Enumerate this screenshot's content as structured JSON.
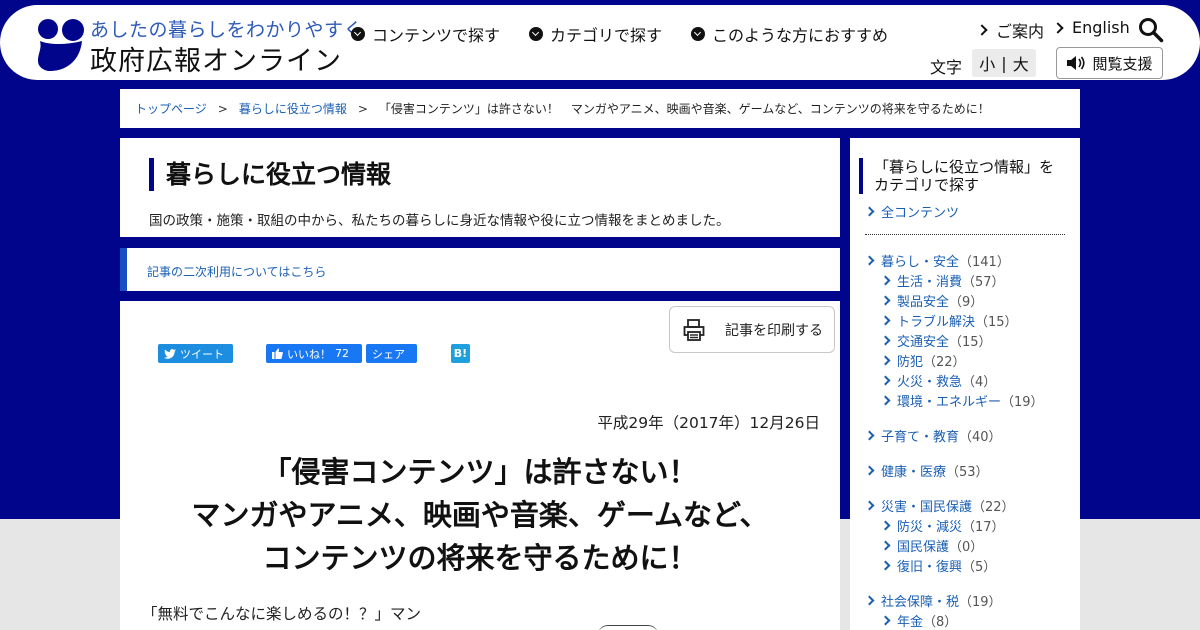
{
  "header": {
    "tagline": "あしたの暮らしをわかりやすく",
    "site_name": "政府広報オンライン",
    "nav": [
      "コンテンツで探す",
      "カテゴリで探す",
      "このような方におすすめ"
    ],
    "guide": "ご案内",
    "english": "English",
    "font_label": "文字",
    "font_small": "小",
    "font_sep": "|",
    "font_large": "大",
    "access_support": "閲覧支援"
  },
  "breadcrumb": {
    "top": "トップページ",
    "category": "暮らしに役立つ情報",
    "current": "「侵害コンテンツ」は許さない！　マンガやアニメ、映画や音楽、ゲームなど、コンテンツの将来を守るために！",
    "sep": ">"
  },
  "category_header": {
    "title": "暮らしに役立つ情報",
    "description": "国の政策・施策・取組の中から、私たちの暮らしに身近な情報や役に立つ情報をまとめました。"
  },
  "reuse_link": "記事の二次利用についてはこちら",
  "article": {
    "print_label": "記事を印刷する",
    "tweet": "ツイート",
    "like": "いいね！",
    "like_count": "72",
    "share": "シェア",
    "hatena": "B!",
    "date": "平成29年（2017年）12月26日",
    "headline_lines": [
      "「侵害コンテンツ」は許さない！",
      "マンガやアニメ、映画や音楽、ゲームなど、",
      "コンテンツの将来を守るために！"
    ],
    "lead": "「無料でこんなに楽しめるの！？」マン"
  },
  "sidebar": {
    "title_line1": "「暮らしに役立つ情報」を",
    "title_line2": "カテゴリで探す",
    "all": "全コンテンツ",
    "groups": [
      {
        "label": "暮らし・安全",
        "count": "（141）",
        "children": [
          {
            "label": "生活・消費",
            "count": "（57）"
          },
          {
            "label": "製品安全",
            "count": "（9）"
          },
          {
            "label": "トラブル解決",
            "count": "（15）"
          },
          {
            "label": "交通安全",
            "count": "（15）"
          },
          {
            "label": "防犯",
            "count": "（22）"
          },
          {
            "label": "火災・救急",
            "count": "（4）"
          },
          {
            "label": "環境・エネルギー",
            "count": "（19）"
          }
        ]
      },
      {
        "label": "子育て・教育",
        "count": "（40）",
        "children": []
      },
      {
        "label": "健康・医療",
        "count": "（53）",
        "children": []
      },
      {
        "label": "災害・国民保護",
        "count": "（22）",
        "children": [
          {
            "label": "防災・減災",
            "count": "（17）"
          },
          {
            "label": "国民保護",
            "count": "（0）"
          },
          {
            "label": "復旧・復興",
            "count": "（5）"
          }
        ]
      },
      {
        "label": "社会保障・税",
        "count": "（19）",
        "children": [
          {
            "label": "年金",
            "count": "（8）"
          }
        ]
      }
    ]
  },
  "colors": {
    "navy": "#00058c",
    "link": "#1a5fb4",
    "accent_blue": "#1a4fc4",
    "twitter": "#1d8de0",
    "facebook": "#1877f2"
  }
}
